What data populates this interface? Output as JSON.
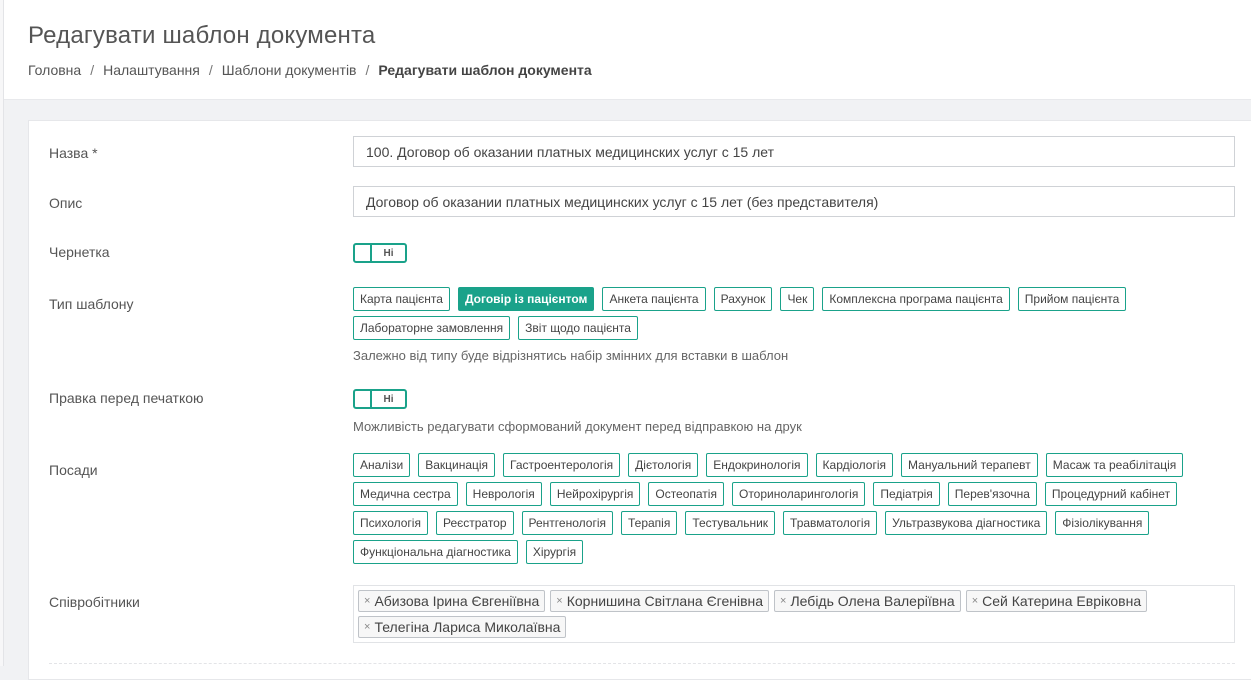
{
  "header": {
    "title": "Редагувати шаблон документа",
    "breadcrumb": [
      "Головна",
      "Налаштування",
      "Шаблони документів"
    ],
    "breadcrumb_current": "Редагувати шаблон документа",
    "separator": "/"
  },
  "form": {
    "name": {
      "label": "Назва *",
      "value": "100. Договор об оказании платных медицинских услуг с 15 лет"
    },
    "description": {
      "label": "Опис",
      "value": "Договор об оказании платных медицинских услуг с 15 лет (без представителя)"
    },
    "draft": {
      "label": "Чернетка",
      "toggle_text": "Ні"
    },
    "template_type": {
      "label": "Тип шаблону",
      "options": [
        "Карта пацієнта",
        "Договір із пацієнтом",
        "Анкета пацієнта",
        "Рахунок",
        "Чек",
        "Комплексна програма пацієнта",
        "Прийом пацієнта",
        "Лабораторне замовлення",
        "Звіт щодо пацієнта"
      ],
      "selected": "Договір із пацієнтом",
      "hint": "Залежно від типу буде відрізнятись набір змінних для вставки в шаблон"
    },
    "edit_before_print": {
      "label": "Правка перед печаткою",
      "toggle_text": "Ні",
      "hint": "Можливість редагувати сформований документ перед відправкою на друк"
    },
    "positions": {
      "label": "Посади",
      "options": [
        "Аналізи",
        "Вакцинація",
        "Гастроентерологія",
        "Дієтологія",
        "Ендокринологія",
        "Кардіологія",
        "Мануальний терапевт",
        "Масаж та реабілітація",
        "Медична сестра",
        "Неврологія",
        "Нейрохірургія",
        "Остеопатія",
        "Оториноларингологія",
        "Педіатрія",
        "Перев'язочна",
        "Процедурний кабінет",
        "Психологія",
        "Реєстратор",
        "Рентгенологія",
        "Терапія",
        "Тестувальник",
        "Травматологія",
        "Ультразвукова діагностика",
        "Фізіолікування",
        "Функціональна діагностика",
        "Хірургія"
      ]
    },
    "employees": {
      "label": "Співробітники",
      "remove_glyph": "×",
      "selected": [
        "Абизова Ірина Євгеніївна",
        "Корнишина Світлана Єгенівна",
        "Лебідь Олена Валеріївна",
        "Сей Катерина Евріковна",
        "Телегіна Лариса Миколаївна"
      ]
    }
  },
  "colors": {
    "accent": "#1aa28a",
    "border": "#cfd2d6",
    "background": "#f1f2f4"
  }
}
